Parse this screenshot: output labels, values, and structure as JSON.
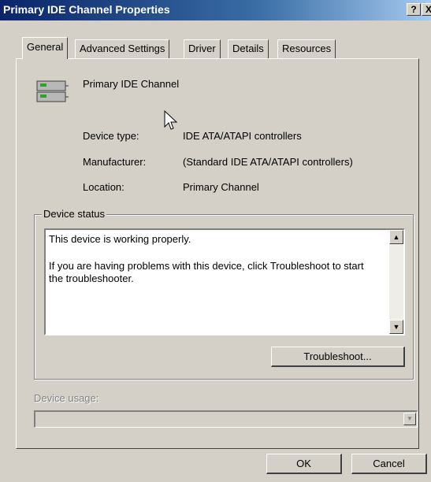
{
  "window": {
    "title": "Primary IDE Channel Properties",
    "help_button": "?",
    "close_button": "X"
  },
  "tabs": [
    {
      "label": "General",
      "active": true
    },
    {
      "label": "Advanced Settings",
      "active": false
    },
    {
      "label": "Driver",
      "active": false
    },
    {
      "label": "Details",
      "active": false
    },
    {
      "label": "Resources",
      "active": false
    }
  ],
  "device": {
    "name": "Primary IDE Channel",
    "icon": "ide-controller-icon",
    "fields": [
      {
        "label": "Device type:",
        "value": "IDE ATA/ATAPI controllers"
      },
      {
        "label": "Manufacturer:",
        "value": "(Standard IDE ATA/ATAPI controllers)"
      },
      {
        "label": "Location:",
        "value": "Primary Channel"
      }
    ]
  },
  "device_status": {
    "group_label": "Device status",
    "line1": "This device is working properly.",
    "line2": "If you are having problems with this device, click Troubleshoot to start the troubleshooter.",
    "troubleshoot_label": "Troubleshoot..."
  },
  "device_usage": {
    "label": "Device usage:",
    "value": ""
  },
  "buttons": {
    "ok": "OK",
    "cancel": "Cancel"
  }
}
